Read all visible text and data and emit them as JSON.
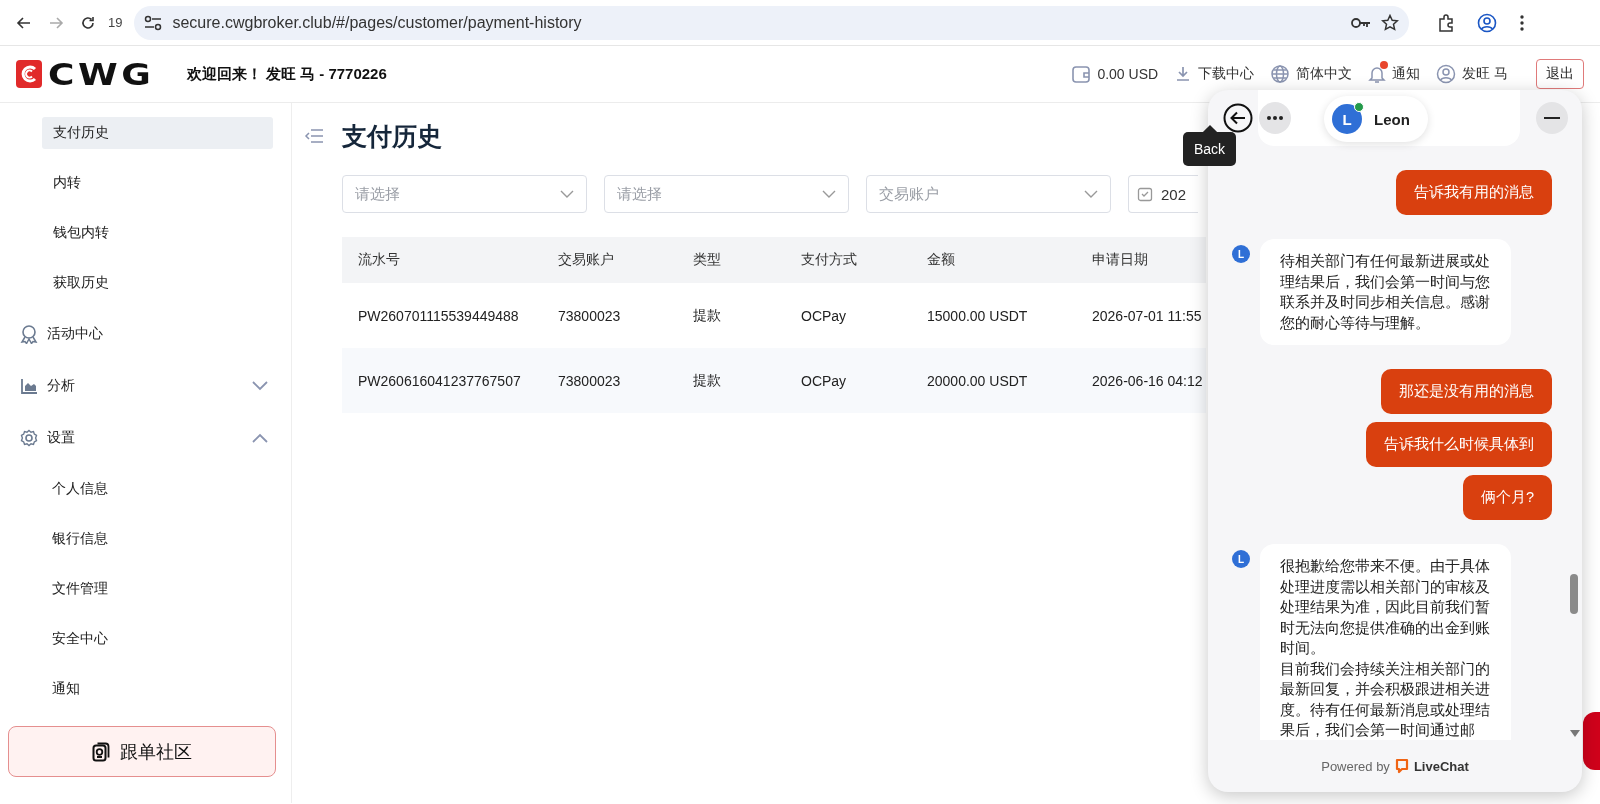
{
  "browser": {
    "tab_count": "19",
    "url": "secure.cwgbroker.club/#/pages/customer/payment-history",
    "forward_disabled": true
  },
  "header": {
    "logo_text": "CWG",
    "welcome": "欢迎回来！ 发旺 马 - 7770226",
    "balance": "0.00 USD",
    "download": "下载中心",
    "language": "简体中文",
    "notifications": {
      "label": "通知",
      "unread": true
    },
    "user": "发旺 马",
    "logout": "退出"
  },
  "sidebar": {
    "sub_items": [
      {
        "label": "支付历史",
        "selected": true
      },
      {
        "label": "内转",
        "selected": false
      },
      {
        "label": "钱包内转",
        "selected": false
      },
      {
        "label": "获取历史",
        "selected": false
      }
    ],
    "groups": [
      {
        "label": "活动中心",
        "kind": "activity"
      },
      {
        "label": "分析",
        "kind": "analytics",
        "expanded": false
      },
      {
        "label": "设置",
        "kind": "settings",
        "expanded": true,
        "children": [
          {
            "label": "个人信息"
          },
          {
            "label": "银行信息"
          },
          {
            "label": "文件管理"
          },
          {
            "label": "安全中心"
          },
          {
            "label": "通知"
          }
        ]
      }
    ],
    "community_button": "跟单社区"
  },
  "page": {
    "title": "支付历史",
    "filters": [
      {
        "kind": "select",
        "placeholder": "请选择"
      },
      {
        "kind": "select",
        "placeholder": "请选择"
      },
      {
        "kind": "select",
        "placeholder": "交易账户"
      },
      {
        "kind": "date",
        "value": "202"
      }
    ],
    "table": {
      "columns": [
        "流水号",
        "交易账户",
        "类型",
        "支付方式",
        "金额",
        "申请日期"
      ],
      "rows": [
        {
          "cells": [
            "PW260701115539449488",
            "73800023",
            "提款",
            "OCPay",
            "15000.00 USDT",
            "2026-07-01 11:55"
          ]
        },
        {
          "cells": [
            "PW260616041237767507",
            "73800023",
            "提款",
            "OCPay",
            "20000.00 USDT",
            "2026-06-16 04:12"
          ]
        }
      ]
    }
  },
  "chat": {
    "back_tooltip": "Back",
    "agent": {
      "avatar": "L",
      "name": "Leon",
      "online": true
    },
    "messages": [
      {
        "kind": "visitor",
        "paragraphs": [
          "告诉我有用的消息"
        ]
      },
      {
        "kind": "agent",
        "avatar": "L",
        "paragraphs": [
          "待相关部门有任何最新进展或处理结果后，我们会第一时间与您联系并及时同步相关信息。感谢您的耐心等待与理解。"
        ]
      },
      {
        "kind": "visitor",
        "paragraphs": [
          "那还是没有用的消息"
        ]
      },
      {
        "kind": "visitor",
        "paragraphs": [
          "告诉我什么时候具体到"
        ]
      },
      {
        "kind": "visitor",
        "paragraphs": [
          "俩个月?"
        ]
      },
      {
        "kind": "agent",
        "avatar": "L",
        "paragraphs": [
          "很抱歉给您带来不便。由于具体处理进度需以相关部门的审核及处理结果为准，因此目前我们暂时无法向您提供准确的出金到账时间。",
          "目前我们会持续关注相关部门的最新回复，并会积极跟进相关进度。待有任何最新消息或处理结果后，我们会第一时间通过邮"
        ]
      }
    ],
    "footer": {
      "powered_by": "Powered by",
      "brand": "LiveChat"
    }
  }
}
